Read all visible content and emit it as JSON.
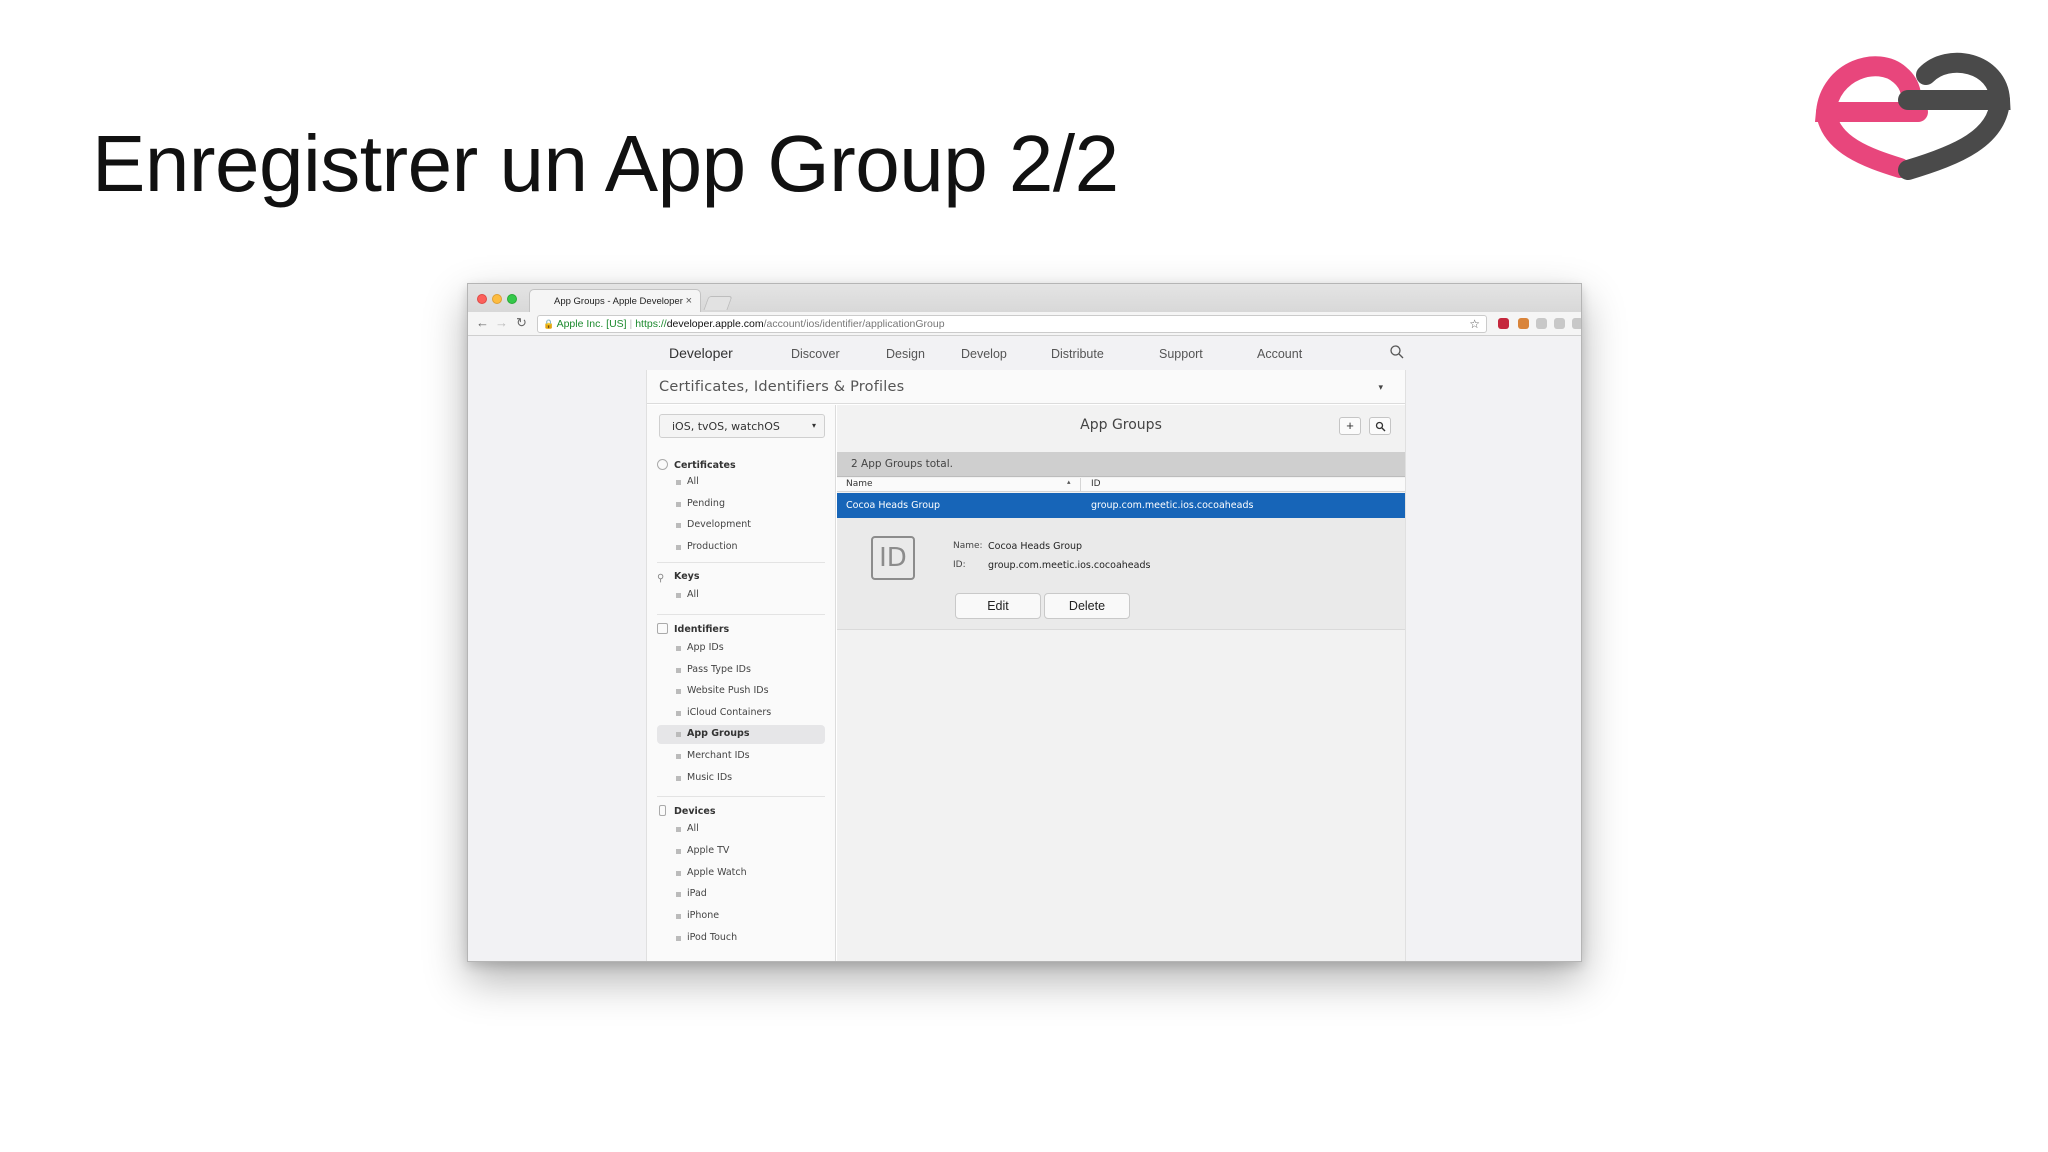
{
  "slide": {
    "title": "Enregistrer un App Group 2/2",
    "logo": {
      "name": "meetic-logo",
      "colors": {
        "pink": "#e8467c",
        "gray": "#4a4a4a"
      }
    }
  },
  "browser": {
    "tab_title": "App Groups - Apple Developer",
    "tab_close": "×",
    "url_cert": "Apple Inc. [US]",
    "url_scheme": "https://",
    "url_host": "developer.apple.com",
    "url_path": "/account/ios/identifier/applicationGroup",
    "icons": {
      "back": "←",
      "forward": "→",
      "reload": "↻",
      "lock": "🔒",
      "star": "☆",
      "menu": "⋮"
    }
  },
  "nav": {
    "brand": "Developer",
    "apple_icon": "",
    "links": [
      "Discover",
      "Design",
      "Develop",
      "Distribute",
      "Support",
      "Account"
    ]
  },
  "header": {
    "title": "Certificates, Identifiers & Profiles",
    "caret": "▾"
  },
  "sidebar": {
    "platform": "iOS, tvOS, watchOS",
    "platform_caret": "▾",
    "sections": {
      "certificates": {
        "label": "Certificates",
        "items": [
          "All",
          "Pending",
          "Development",
          "Production"
        ]
      },
      "keys": {
        "label": "Keys",
        "items": [
          "All"
        ]
      },
      "identifiers": {
        "label": "Identifiers",
        "items": [
          "App IDs",
          "Pass Type IDs",
          "Website Push IDs",
          "iCloud Containers",
          "App Groups",
          "Merchant IDs",
          "Music IDs"
        ]
      },
      "devices": {
        "label": "Devices",
        "items": [
          "All",
          "Apple TV",
          "Apple Watch",
          "iPad",
          "iPhone",
          "iPod Touch"
        ]
      }
    },
    "active_item": "App Groups"
  },
  "main": {
    "title": "App Groups",
    "add_label": "+",
    "count_text": "2  App Groups total.",
    "columns": {
      "name": "Name",
      "id": "ID",
      "sort": "▴"
    },
    "selected_row": {
      "name": "Cocoa Heads Group",
      "id": "group.com.meetic.ios.cocoaheads"
    },
    "details": {
      "icon_text": "ID",
      "name_label": "Name:",
      "name_value": "Cocoa Heads Group",
      "id_label": "ID:",
      "id_value": "group.com.meetic.ios.cocoaheads",
      "edit_label": "Edit",
      "delete_label": "Delete"
    },
    "accent_color": "#1765b8"
  }
}
